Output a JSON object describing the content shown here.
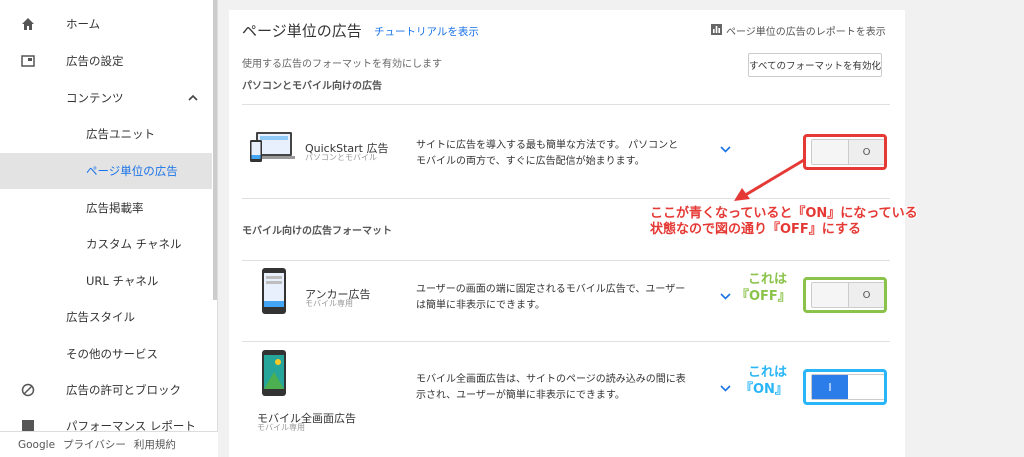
{
  "sidebar": {
    "items": [
      {
        "label": "ホーム",
        "icon": "home-icon"
      },
      {
        "label": "広告の設定",
        "icon": "ad-settings-icon"
      },
      {
        "label": "コンテンツ"
      },
      {
        "label": "広告ユニット"
      },
      {
        "label": "ページ単位の広告"
      },
      {
        "label": "広告掲載率"
      },
      {
        "label": "カスタム チャネル"
      },
      {
        "label": "URL チャネル"
      },
      {
        "label": "広告スタイル"
      },
      {
        "label": "その他のサービス"
      },
      {
        "label": "広告の許可とブロック",
        "icon": "block-icon"
      },
      {
        "label": "パフォーマンス レポート",
        "icon": "report-icon"
      }
    ],
    "footer": {
      "brand": "Google",
      "privacy": "プライバシー",
      "terms": "利用規約"
    }
  },
  "main": {
    "title": "ページ単位の広告",
    "tutorial_link": "チュートリアルを表示",
    "report_link": "ページ単位の広告のレポートを表示",
    "subtitle": "使用する広告のフォーマットを有効にします",
    "enable_all_button": "すべてのフォーマットを有効化",
    "section_desktop_mobile": "パソコンとモバイル向けの広告",
    "section_mobile": "モバイル向けの広告フォーマット",
    "formats": [
      {
        "name": "QuickStart 広告",
        "sub": "パソコンとモバイル",
        "desc": "サイトに広告を導入する最も簡単な方法です。 パソコンとモバイルの両方で、すぐに広告配信が始まります。",
        "toggle": "O"
      },
      {
        "name": "アンカー広告",
        "sub": "モバイル専用",
        "desc": "ユーザーの画面の端に固定されるモバイル広告で、ユーザーは簡単に非表示にできます。",
        "toggle": "O"
      },
      {
        "name": "モバイル全画面広告",
        "sub": "モバイル専用",
        "desc": "モバイル全画面広告は、サイトのページの読み込みの間に表示され、ユーザーが簡単に非表示にできます。",
        "toggle": "I"
      }
    ]
  },
  "annotations": {
    "red_line1": "ここが青くなっていると『ON』になっている",
    "red_line2": "状態なので図の通り『OFF』にする",
    "green_line1": "これは",
    "green_line2": "『OFF』",
    "blue_line1": "これは",
    "blue_line2": "『ON』"
  },
  "colors": {
    "accent": "#1a73e8",
    "red": "#e53935",
    "green": "#8bc34a",
    "blue": "#29b6f6"
  }
}
